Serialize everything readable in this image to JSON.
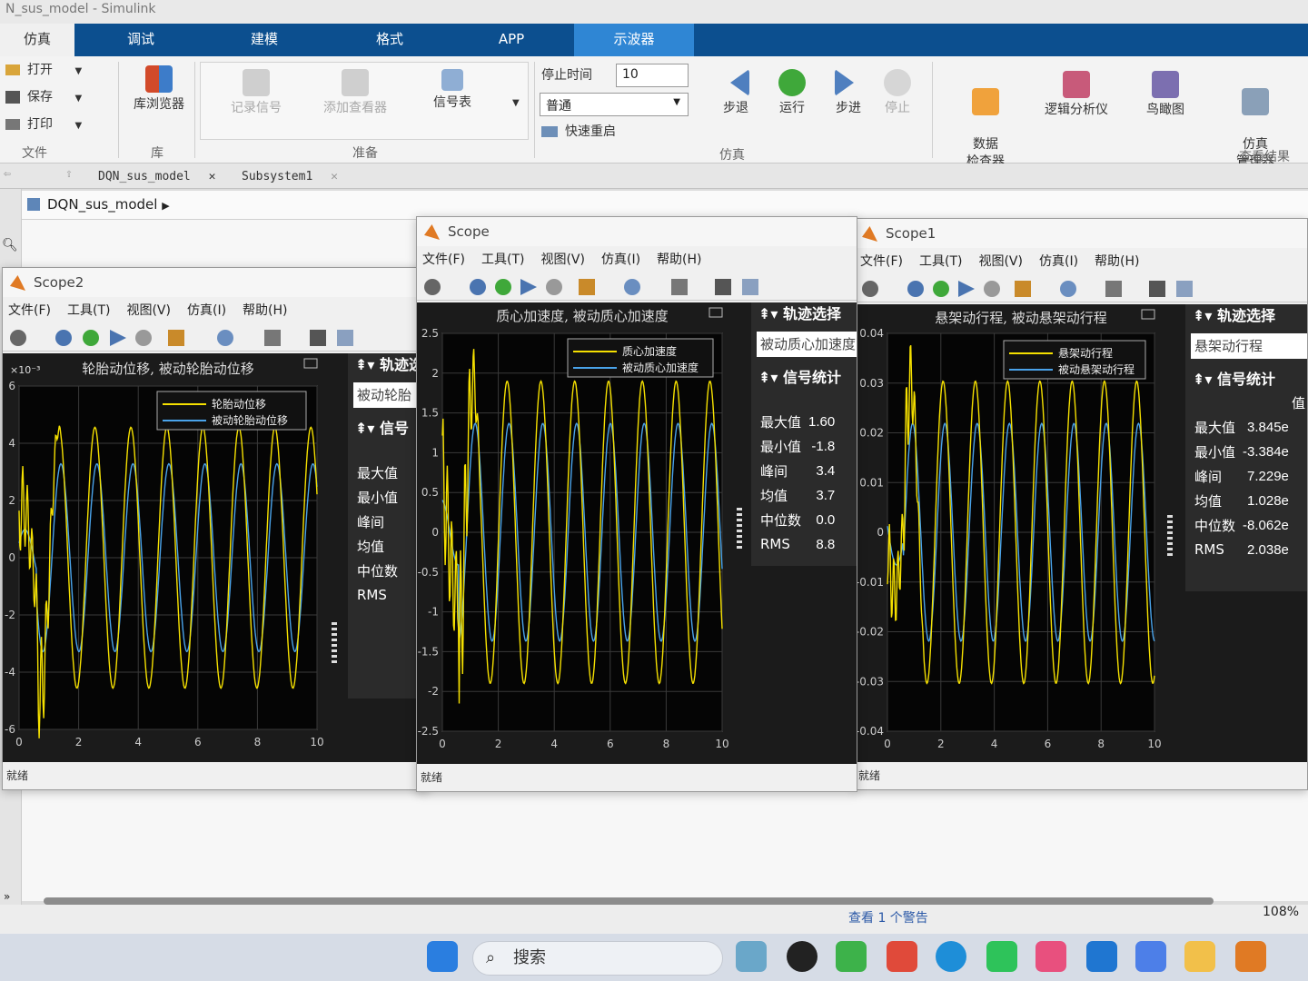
{
  "window": {
    "title": "N_sus_model - Simulink"
  },
  "ribbon_tabs": [
    "仿真",
    "调试",
    "建模",
    "格式",
    "APP",
    "示波器"
  ],
  "file_group": {
    "open": "打开",
    "save": "保存",
    "print": "打印",
    "label": "文件"
  },
  "library": {
    "button": "库浏览器",
    "label": "库"
  },
  "prepare": {
    "record": "记录信号",
    "add_viewer": "添加查看器",
    "signal_table": "信号表",
    "label": "准备"
  },
  "simulate": {
    "stop_time_label": "停止时间",
    "stop_time": "10",
    "mode": "普通",
    "fast_restart": "快速重启",
    "step_back": "步退",
    "run": "运行",
    "step_forward": "步进",
    "stop": "停止",
    "label": "仿真"
  },
  "review": {
    "data_inspector": "数据\n检查器",
    "logic_analyzer": "逻辑分析仪",
    "bird_eye": "鸟瞰图",
    "sim_manager": "仿真\n管理器",
    "label": "查看结果"
  },
  "doc_tabs": [
    "DQN_sus_model",
    "Subsystem1"
  ],
  "breadcrumb": "DQN_sus_model",
  "statusbar": {
    "warning": "查看 1 个警告",
    "zoom": "108%"
  },
  "taskbar": {
    "search": "搜索"
  },
  "scope_menu": [
    "文件(F)",
    "工具(T)",
    "视图(V)",
    "仿真(I)",
    "帮助(H)"
  ],
  "scopes": [
    {
      "title": "Scope2",
      "plot_title": "轮胎动位移, 被动轮胎动位移",
      "exponent": "×10⁻³",
      "y_ticks": [
        "6",
        "4",
        "2",
        "0",
        "-2",
        "-4",
        "-6"
      ],
      "x_ticks": [
        "0",
        "2",
        "4",
        "6",
        "8",
        "10"
      ],
      "legend": [
        "轮胎动位移",
        "被动轮胎动位移"
      ],
      "trace_select": "轨迹选",
      "trace_value": "被动轮胎",
      "stats_header": "信号",
      "stats": [
        {
          "name": "最大值",
          "value": ""
        },
        {
          "name": "最小值",
          "value": ""
        },
        {
          "name": "峰间",
          "value": ""
        },
        {
          "name": "均值",
          "value": ""
        },
        {
          "name": "中位数",
          "value": ""
        },
        {
          "name": "RMS",
          "value": ""
        }
      ],
      "status": "就绪"
    },
    {
      "title": "Scope",
      "plot_title": "质心加速度, 被动质心加速度",
      "exponent": "",
      "y_ticks": [
        "2.5",
        "2",
        "1.5",
        "1",
        "0.5",
        "0",
        "-0.5",
        "-1",
        "-1.5",
        "-2",
        "-2.5"
      ],
      "x_ticks": [
        "0",
        "2",
        "4",
        "6",
        "8",
        "10"
      ],
      "legend": [
        "质心加速度",
        "被动质心加速度"
      ],
      "trace_select": "轨迹选择",
      "trace_value": "被动质心加速度",
      "stats_header": "信号统计",
      "stats": [
        {
          "name": "最大值",
          "value": "1.60"
        },
        {
          "name": "最小值",
          "value": "-1.8"
        },
        {
          "name": "峰间",
          "value": "3.4"
        },
        {
          "name": "均值",
          "value": "3.7"
        },
        {
          "name": "中位数",
          "value": "0.0"
        },
        {
          "name": "RMS",
          "value": "8.8"
        }
      ],
      "status": "就绪"
    },
    {
      "title": "Scope1",
      "plot_title": "悬架动行程, 被动悬架动行程",
      "exponent": "",
      "y_ticks": [
        "0.04",
        "0.03",
        "0.02",
        "0.01",
        "0",
        "-0.01",
        "-0.02",
        "-0.03",
        "-0.04"
      ],
      "x_ticks": [
        "0",
        "2",
        "4",
        "6",
        "8",
        "10"
      ],
      "legend": [
        "悬架动行程",
        "被动悬架动行程"
      ],
      "trace_select": "轨迹选择",
      "trace_value": "悬架动行程",
      "stats_header": "信号统计",
      "stats_col": "值",
      "stats": [
        {
          "name": "最大值",
          "value": "3.845e"
        },
        {
          "name": "最小值",
          "value": "-3.384e"
        },
        {
          "name": "峰间",
          "value": "7.229e"
        },
        {
          "name": "均值",
          "value": "1.028e"
        },
        {
          "name": "中位数",
          "value": "-8.062e"
        },
        {
          "name": "RMS",
          "value": "2.038e"
        }
      ],
      "status": "就绪"
    }
  ],
  "colors": {
    "active_series": "#f5e000",
    "passive_series": "#4aa3ea",
    "ribbon": "#0c4f8f",
    "ribbon_active": "#2f86d4"
  }
}
